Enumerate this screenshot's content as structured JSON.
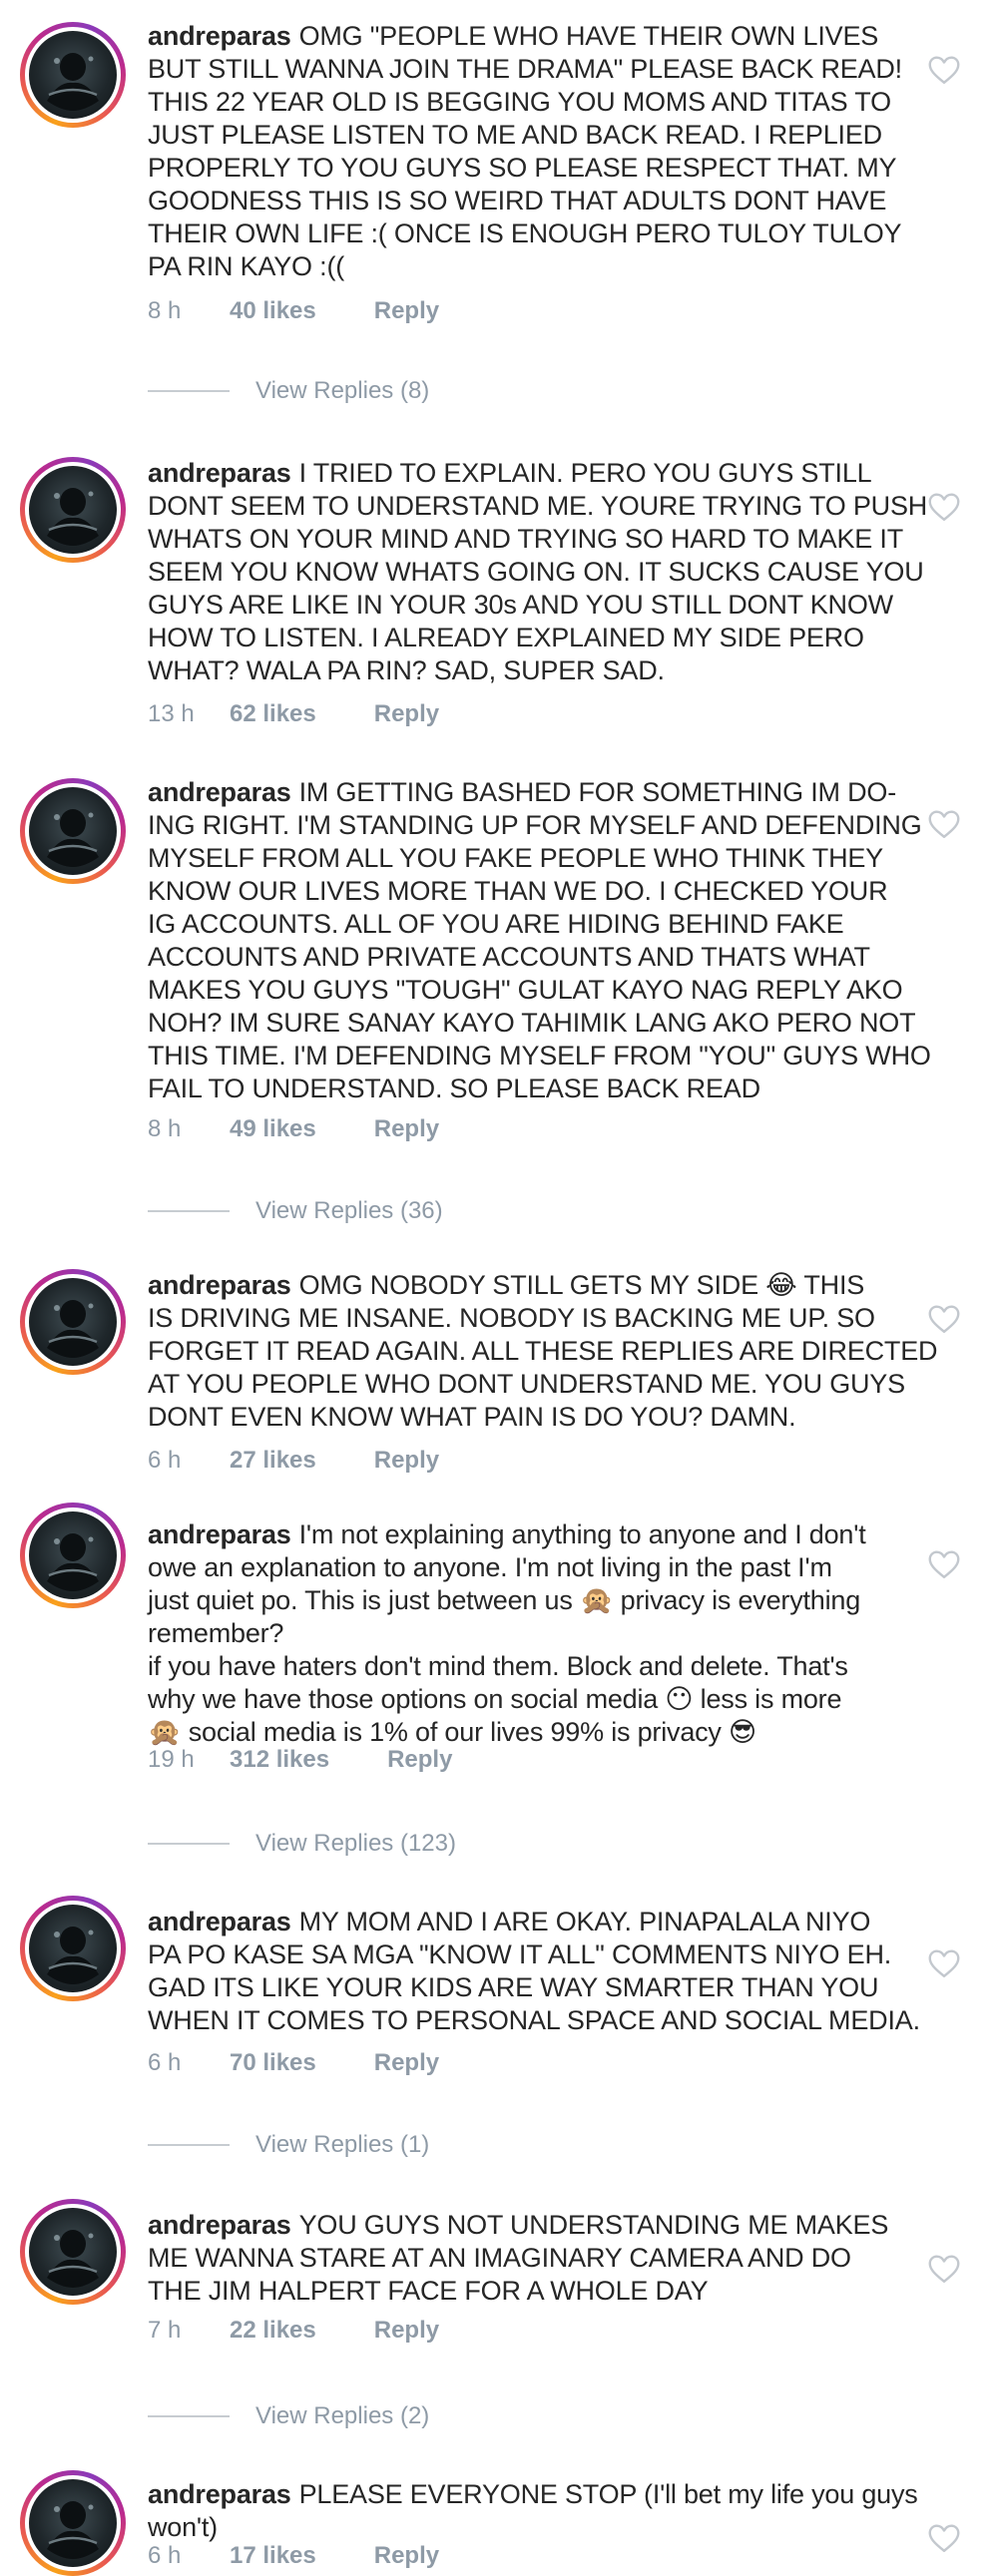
{
  "comments": [
    {
      "username": "andreparas",
      "lines": [
        "OMG \"PEOPLE WHO HAVE THEIR OWN LIVES",
        "BUT STILL WANNA JOIN THE DRAMA\" PLEASE BACK READ!",
        "THIS 22 YEAR OLD IS BEGGING YOU MOMS AND TITAS TO",
        "JUST PLEASE LISTEN TO ME AND BACK READ. I REPLIED",
        "PROPERLY TO YOU GUYS SO PLEASE RESPECT THAT. MY",
        "GOODNESS THIS IS SO WEIRD THAT ADULTS DONT HAVE",
        "THEIR OWN LIFE :( ONCE IS ENOUGH PERO TULOY TULOY",
        "PA RIN KAYO :(("
      ],
      "time": "8 h",
      "likes": "40 likes",
      "reply": "Reply",
      "view_replies": "View Replies (8)"
    },
    {
      "username": "andreparas",
      "lines": [
        "I TRIED TO EXPLAIN. PERO YOU GUYS STILL",
        "DONT SEEM TO UNDERSTAND ME. YOURE TRYING TO PUSH",
        "WHATS ON YOUR MIND AND TRYING SO HARD TO MAKE IT",
        "SEEM YOU KNOW WHATS GOING ON. IT SUCKS CAUSE YOU",
        "GUYS ARE LIKE IN YOUR 30s AND YOU STILL DONT KNOW",
        "HOW TO LISTEN. I ALREADY EXPLAINED MY SIDE PERO",
        "WHAT? WALA PA RIN? SAD, SUPER SAD."
      ],
      "time": "13 h",
      "likes": "62 likes",
      "reply": "Reply",
      "view_replies": ""
    },
    {
      "username": "andreparas",
      "lines": [
        "IM GETTING BASHED FOR SOMETHING IM DO-",
        "ING RIGHT. I'M STANDING UP FOR MYSELF AND DEFENDING",
        "MYSELF FROM ALL YOU FAKE PEOPLE WHO THINK THEY",
        "KNOW OUR LIVES MORE THAN WE DO. I CHECKED YOUR",
        "IG ACCOUNTS. ALL OF YOU ARE HIDING BEHIND FAKE",
        "ACCOUNTS AND PRIVATE ACCOUNTS AND THATS WHAT",
        "MAKES YOU GUYS \"TOUGH\" GULAT KAYO NAG REPLY AKO",
        "NOH? IM SURE SANAY KAYO TAHIMIK LANG AKO PERO NOT",
        "THIS TIME. I'M DEFENDING MYSELF FROM \"YOU\" GUYS WHO",
        "FAIL TO UNDERSTAND. SO PLEASE BACK READ"
      ],
      "time": "8 h",
      "likes": "49 likes",
      "reply": "Reply",
      "view_replies": "View Replies (36)"
    },
    {
      "username": "andreparas",
      "lines": [
        "OMG NOBODY STILL GETS MY SIDE 😂 THIS",
        "IS DRIVING ME INSANE. NOBODY IS BACKING ME UP. SO",
        "FORGET IT READ AGAIN. ALL THESE REPLIES ARE DIRECTED",
        "AT YOU PEOPLE WHO DONT UNDERSTAND ME. YOU GUYS",
        "DONT EVEN KNOW WHAT PAIN IS DO YOU? DAMN."
      ],
      "time": "6 h",
      "likes": "27 likes",
      "reply": "Reply",
      "view_replies": ""
    },
    {
      "username": "andreparas",
      "lines": [
        "I'm not explaining anything to anyone and I don't",
        "owe an explanation to anyone. I'm not living in the past I'm",
        "just quiet po. This is just between us 🙊 privacy is everything",
        "remember?",
        "if you have haters don't mind them. Block and delete. That's",
        "why we have those options on social media 😶 less is more",
        "🙊 social media is 1% of our lives 99% is privacy 😎"
      ],
      "time": "19 h",
      "likes": "312 likes",
      "reply": "Reply",
      "view_replies": "View Replies (123)"
    },
    {
      "username": "andreparas",
      "lines": [
        "MY MOM AND I ARE OKAY. PINAPALALA NIYO",
        "PA PO KASE SA MGA \"KNOW IT ALL\" COMMENTS NIYO EH.",
        "GAD ITS LIKE YOUR KIDS ARE WAY SMARTER THAN YOU",
        "WHEN IT COMES TO PERSONAL SPACE AND SOCIAL MEDIA."
      ],
      "time": "6 h",
      "likes": "70 likes",
      "reply": "Reply",
      "view_replies": "View Replies (1)"
    },
    {
      "username": "andreparas",
      "lines": [
        "YOU GUYS NOT UNDERSTANDING ME MAKES",
        "ME WANNA STARE AT AN IMAGINARY CAMERA AND DO",
        "THE JIM HALPERT FACE FOR A WHOLE DAY"
      ],
      "time": "7 h",
      "likes": "22 likes",
      "reply": "Reply",
      "view_replies": "View Replies (2)"
    },
    {
      "username": "andreparas",
      "lines": [
        "PLEASE EVERYONE STOP (I'll bet my life you guys",
        "won't)"
      ],
      "time": "6 h",
      "likes": "17 likes",
      "reply": "Reply",
      "view_replies": ""
    }
  ],
  "icons": {
    "like": "heart-outline-icon",
    "avatar": "profile-photo"
  },
  "colors": {
    "text": "#262626",
    "meta": "#8e9aa6",
    "heart": "#c3c8ce"
  }
}
